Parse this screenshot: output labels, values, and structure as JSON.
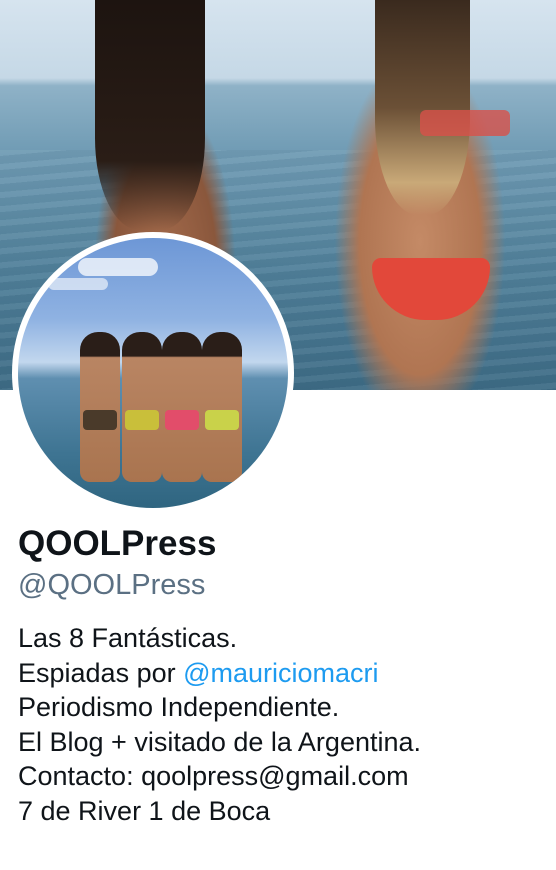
{
  "profile": {
    "display_name": "QOOLPress",
    "handle": "@QOOLPress",
    "bio": {
      "line1": "Las 8 Fantásticas.",
      "line2_prefix": "Espiadas por ",
      "line2_mention": "@mauriciomacri",
      "line3": "Periodismo Independiente.",
      "line4": "El Blog + visitado de la Argentina.",
      "line5": "Contacto: qoolpress@gmail.com",
      "line6": "7 de River 1 de Boca"
    }
  },
  "colors": {
    "text_primary": "#0f1419",
    "text_secondary": "#5b7083",
    "link": "#1d9bf0",
    "background": "#ffffff"
  }
}
